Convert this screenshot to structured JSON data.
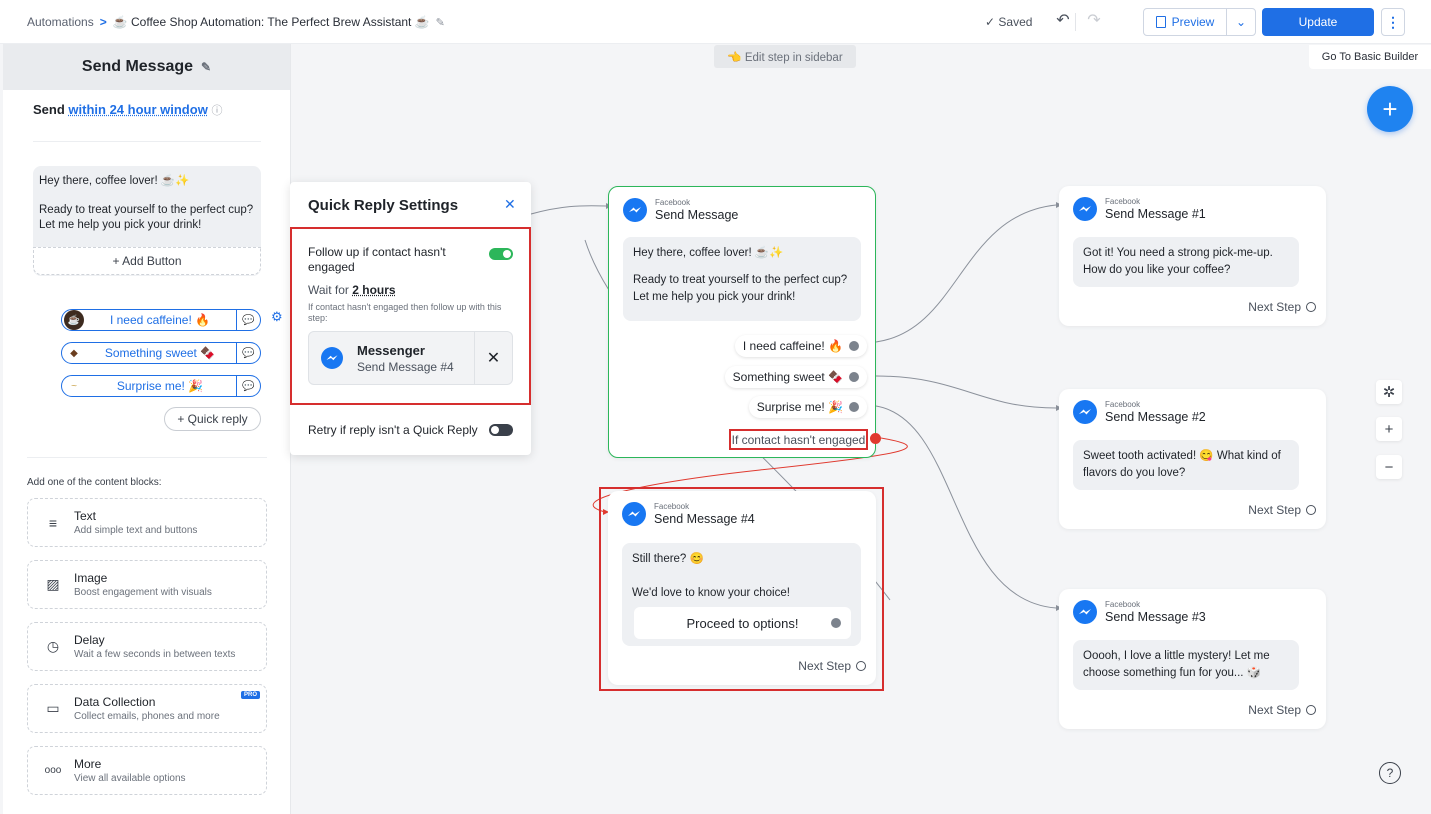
{
  "topbar": {
    "crumb_root": "Automations",
    "crumb_sep": ">",
    "crumb_title": "☕ Coffee Shop Automation: The Perfect Brew Assistant ☕",
    "saved": "✓ Saved",
    "preview": "Preview",
    "update": "Update",
    "basic_builder": "Go To Basic Builder"
  },
  "sidebar": {
    "title": "Send Message",
    "send_label": "Send",
    "send_window": "within 24 hour window",
    "message_line1": "Hey there, coffee lover! ☕✨",
    "message_line2": "Ready to treat yourself to the perfect cup? Let me help you pick your drink!",
    "add_button": "+ Add Button",
    "quick_replies": [
      {
        "label": "I need caffeine! 🔥"
      },
      {
        "label": "Something sweet 🍫"
      },
      {
        "label": "Surprise me! 🎉"
      }
    ],
    "add_quick_reply": "+ Quick reply",
    "blocks_title": "Add one of the content blocks:",
    "blocks": [
      {
        "title": "Text",
        "desc": "Add simple text and buttons"
      },
      {
        "title": "Image",
        "desc": "Boost engagement with visuals"
      },
      {
        "title": "Delay",
        "desc": "Wait a few seconds in between texts"
      },
      {
        "title": "Data Collection",
        "desc": "Collect emails, phones and more",
        "badge": "PRO"
      },
      {
        "title": "More",
        "desc": "View all available options"
      }
    ]
  },
  "quick_reply_settings": {
    "title": "Quick Reply Settings",
    "follow_up": "Follow up if contact hasn't engaged",
    "follow_up_enabled": true,
    "wait_prefix": "Wait for",
    "wait_value": "2 hours",
    "wait_desc": "If contact hasn't engaged then follow up with this step:",
    "card_title": "Messenger",
    "card_sub": "Send Message #4",
    "retry": "Retry if reply isn't a Quick Reply",
    "retry_enabled": false
  },
  "canvas": {
    "edit_hint": "👈 Edit step in sidebar",
    "main_node": {
      "source": "Facebook",
      "name": "Send Message",
      "line1": "Hey there, coffee lover! ☕✨",
      "line2": "Ready to treat yourself to the perfect cup? Let me help you pick your drink!",
      "options": [
        "I need caffeine! 🔥",
        "Something sweet 🍫",
        "Surprise me! 🎉"
      ],
      "not_engaged": "If contact hasn't engaged"
    },
    "node1": {
      "source": "Facebook",
      "name": "Send Message #1",
      "text": "Got it! You need a strong pick-me-up. How do you like your coffee?",
      "next": "Next Step"
    },
    "node2": {
      "source": "Facebook",
      "name": "Send Message #2",
      "text": "Sweet tooth activated! 😋 What kind of flavors do you love?",
      "next": "Next Step"
    },
    "node3": {
      "source": "Facebook",
      "name": "Send Message #3",
      "text": "Ooooh, I love a little mystery! Let me choose something fun for you... 🎲",
      "next": "Next Step"
    },
    "node4": {
      "source": "Facebook",
      "name": "Send Message #4",
      "line1": "Still there? 😊",
      "line2": "We'd love to know your choice!",
      "button": "Proceed to options!",
      "next": "Next Step"
    }
  },
  "colors": {
    "accent": "#1f6fe5",
    "highlight": "#d62e2e",
    "active_border": "#2cb65a"
  },
  "icons": {
    "fab": "plus-icon",
    "zoom_in": "plus-icon",
    "zoom_out": "minus-icon",
    "auto": "magic-icon",
    "help": "question-icon"
  }
}
